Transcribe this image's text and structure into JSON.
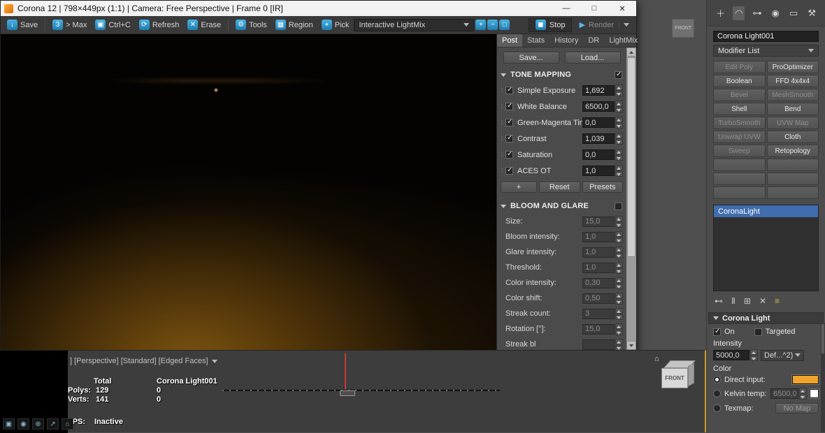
{
  "colors": {
    "toolbar_icon_blue": "#2f8fc5",
    "selection_blue": "#3f6dae",
    "light_color_swatch": "#f0a42c",
    "kelvin_swatch": "#ffffff",
    "viewport_active_border": "#c9a22c",
    "render_glow": "#6b4a10"
  },
  "icons": {
    "save": "↓",
    "to_max": "3",
    "copy": "▣",
    "refresh": "⟳",
    "erase": "✕",
    "tools": "⚙",
    "region": "▦",
    "pick": "⌖",
    "zoom_in": "+",
    "zoom_out": "−",
    "zoom_fit": "□",
    "stop": "◼",
    "render_play": "▶",
    "minimize": "—",
    "maximize": "□",
    "close": "✕",
    "create_tab": "＋",
    "modify_tab": "◠",
    "hierarchy_tab": "⊶",
    "motion_tab": "◉",
    "display_tab": "▭",
    "utilities_tab": "⚒",
    "pin_stack": "⊷",
    "show_end_result": "Ⅱ",
    "make_unique": "⊞",
    "remove_modifier": "✕",
    "configure_sets": "≡",
    "home": "⌂",
    "status_1": "▣",
    "status_2": "◉",
    "status_3": "⊕",
    "status_4": "↗",
    "status_5": "⌂"
  },
  "vfb": {
    "titlebar": {
      "title": "Corona 12 | 798×449px (1:1) | Camera: Free Perspective | Frame 0 [IR]"
    },
    "toolbar": {
      "save": "Save",
      "to_max": "> Max",
      "copy": "Ctrl+C",
      "refresh": "Refresh",
      "erase": "Erase",
      "tools": "Tools",
      "region": "Region",
      "pick": "Pick",
      "lightmix_dropdown": "Interactive LightMix",
      "stop": "Stop",
      "render": "Render"
    },
    "tabs": {
      "post": "Post",
      "stats": "Stats",
      "history": "History",
      "dr": "DR",
      "lightmix": "LightMix"
    },
    "actions": {
      "save": "Save...",
      "load": "Load..."
    },
    "tone_mapping": {
      "title": "TONE MAPPING",
      "rows": [
        {
          "label": "Simple Exposure",
          "value": "1,692"
        },
        {
          "label": "White Balance",
          "value": "6500,0"
        },
        {
          "label": "Green-Magenta Tint",
          "value": "0,0"
        },
        {
          "label": "Contrast",
          "value": "1,039"
        },
        {
          "label": "Saturation",
          "value": "0,0"
        },
        {
          "label": "ACES OT",
          "value": "1,0"
        }
      ],
      "add": "+",
      "reset": "Reset",
      "presets": "Presets"
    },
    "bloom_glare": {
      "title": "BLOOM AND GLARE",
      "rows": [
        {
          "label": "Size:",
          "value": "15,0"
        },
        {
          "label": "Bloom intensity:",
          "value": "1,0"
        },
        {
          "label": "Glare intensity:",
          "value": "1,0"
        },
        {
          "label": "Threshold:",
          "value": "1,0"
        },
        {
          "label": "Color intensity:",
          "value": "0,30"
        },
        {
          "label": "Color shift:",
          "value": "0,50"
        },
        {
          "label": "Streak count:",
          "value": "3"
        },
        {
          "label": "Rotation [°]:",
          "value": "15,0"
        },
        {
          "label": "Streak bl",
          "value": ""
        }
      ]
    }
  },
  "viewport": {
    "label_bar": "] [Perspective] [Standard] [Edged Faces]",
    "stats": {
      "total_label": "Total",
      "polys_label": "Polys:",
      "polys_value": "129",
      "verts_label": "Verts:",
      "verts_value": "141",
      "object_name": "Corona Light001",
      "object_polys": "0",
      "object_verts": "0",
      "fps_label": "FPS:",
      "fps_value": "Inactive"
    },
    "viewcube_front": "FRONT",
    "front_viewport_label": "FRONT"
  },
  "command_panel": {
    "object_name": "Corona Light001",
    "modifier_list": "Modifier List",
    "modifier_buttons": [
      {
        "label": "Edit Poly",
        "enabled": false
      },
      {
        "label": "ProOptimizer",
        "enabled": true
      },
      {
        "label": "Boolean",
        "enabled": true
      },
      {
        "label": "FFD 4x4x4",
        "enabled": true
      },
      {
        "label": "Bevel",
        "enabled": false
      },
      {
        "label": "MeshSmooth",
        "enabled": false
      },
      {
        "label": "Shell",
        "enabled": true
      },
      {
        "label": "Bend",
        "enabled": true
      },
      {
        "label": "TurboSmooth",
        "enabled": false
      },
      {
        "label": "UVW Map",
        "enabled": false
      },
      {
        "label": "Unwrap UVW",
        "enabled": false
      },
      {
        "label": "Cloth",
        "enabled": true
      },
      {
        "label": "Sweep",
        "enabled": false
      },
      {
        "label": "Retopology",
        "enabled": true
      }
    ],
    "stack": [
      "CoronaLight"
    ],
    "light_rollout": {
      "title": "Corona Light",
      "on": "On",
      "targeted": "Targeted",
      "intensity": "Intensity",
      "intensity_value": "5000,0",
      "units": "Def...^2)",
      "color": "Color",
      "direct_input": "Direct input:",
      "kelvin_temp": "Kelvin temp:",
      "kelvin_value": "6500,0",
      "texmap": "Texmap:",
      "no_map": "No Map"
    }
  }
}
